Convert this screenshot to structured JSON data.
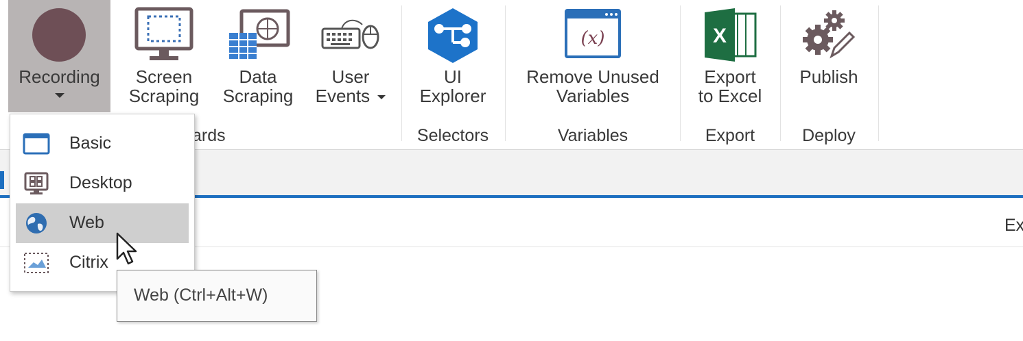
{
  "ribbon": {
    "recording": {
      "label": "Recording",
      "icon": "record-icon"
    },
    "screen_scraping": {
      "line1": "Screen",
      "line2": "Scraping",
      "icon": "screen-scraping-icon"
    },
    "data_scraping": {
      "line1": "Data",
      "line2": "Scraping",
      "icon": "data-scraping-icon"
    },
    "user_events": {
      "line1": "User",
      "line2": "Events",
      "icon": "keyboard-mouse-icon"
    },
    "wizards_group": "ards",
    "ui_explorer": {
      "line1": "UI",
      "line2": "Explorer",
      "icon": "ui-explorer-icon"
    },
    "selectors_group": "Selectors",
    "remove_unused": {
      "line1": "Remove Unused",
      "line2": "Variables",
      "icon": "variable-icon"
    },
    "variables_group": "Variables",
    "export_excel": {
      "line1": "Export",
      "line2": "to Excel",
      "icon": "excel-icon"
    },
    "export_group": "Export",
    "publish": {
      "label": "Publish",
      "icon": "gears-icon"
    },
    "deploy_group": "Deploy"
  },
  "recording_menu": {
    "items": [
      {
        "label": "Basic",
        "icon": "basic-window-icon"
      },
      {
        "label": "Desktop",
        "icon": "desktop-icon"
      },
      {
        "label": "Web",
        "icon": "globe-icon"
      },
      {
        "label": "Citrix",
        "icon": "citrix-icon"
      }
    ],
    "hovered_index": 2
  },
  "tooltip": {
    "text": "Web (Ctrl+Alt+W)"
  },
  "content": {
    "partial_text": "Ex"
  },
  "colors": {
    "accent": "#1d6fc0",
    "recording_bg": "#b8b4b4",
    "record_dot": "#6e4f56",
    "excel_green": "#1e6e42"
  }
}
